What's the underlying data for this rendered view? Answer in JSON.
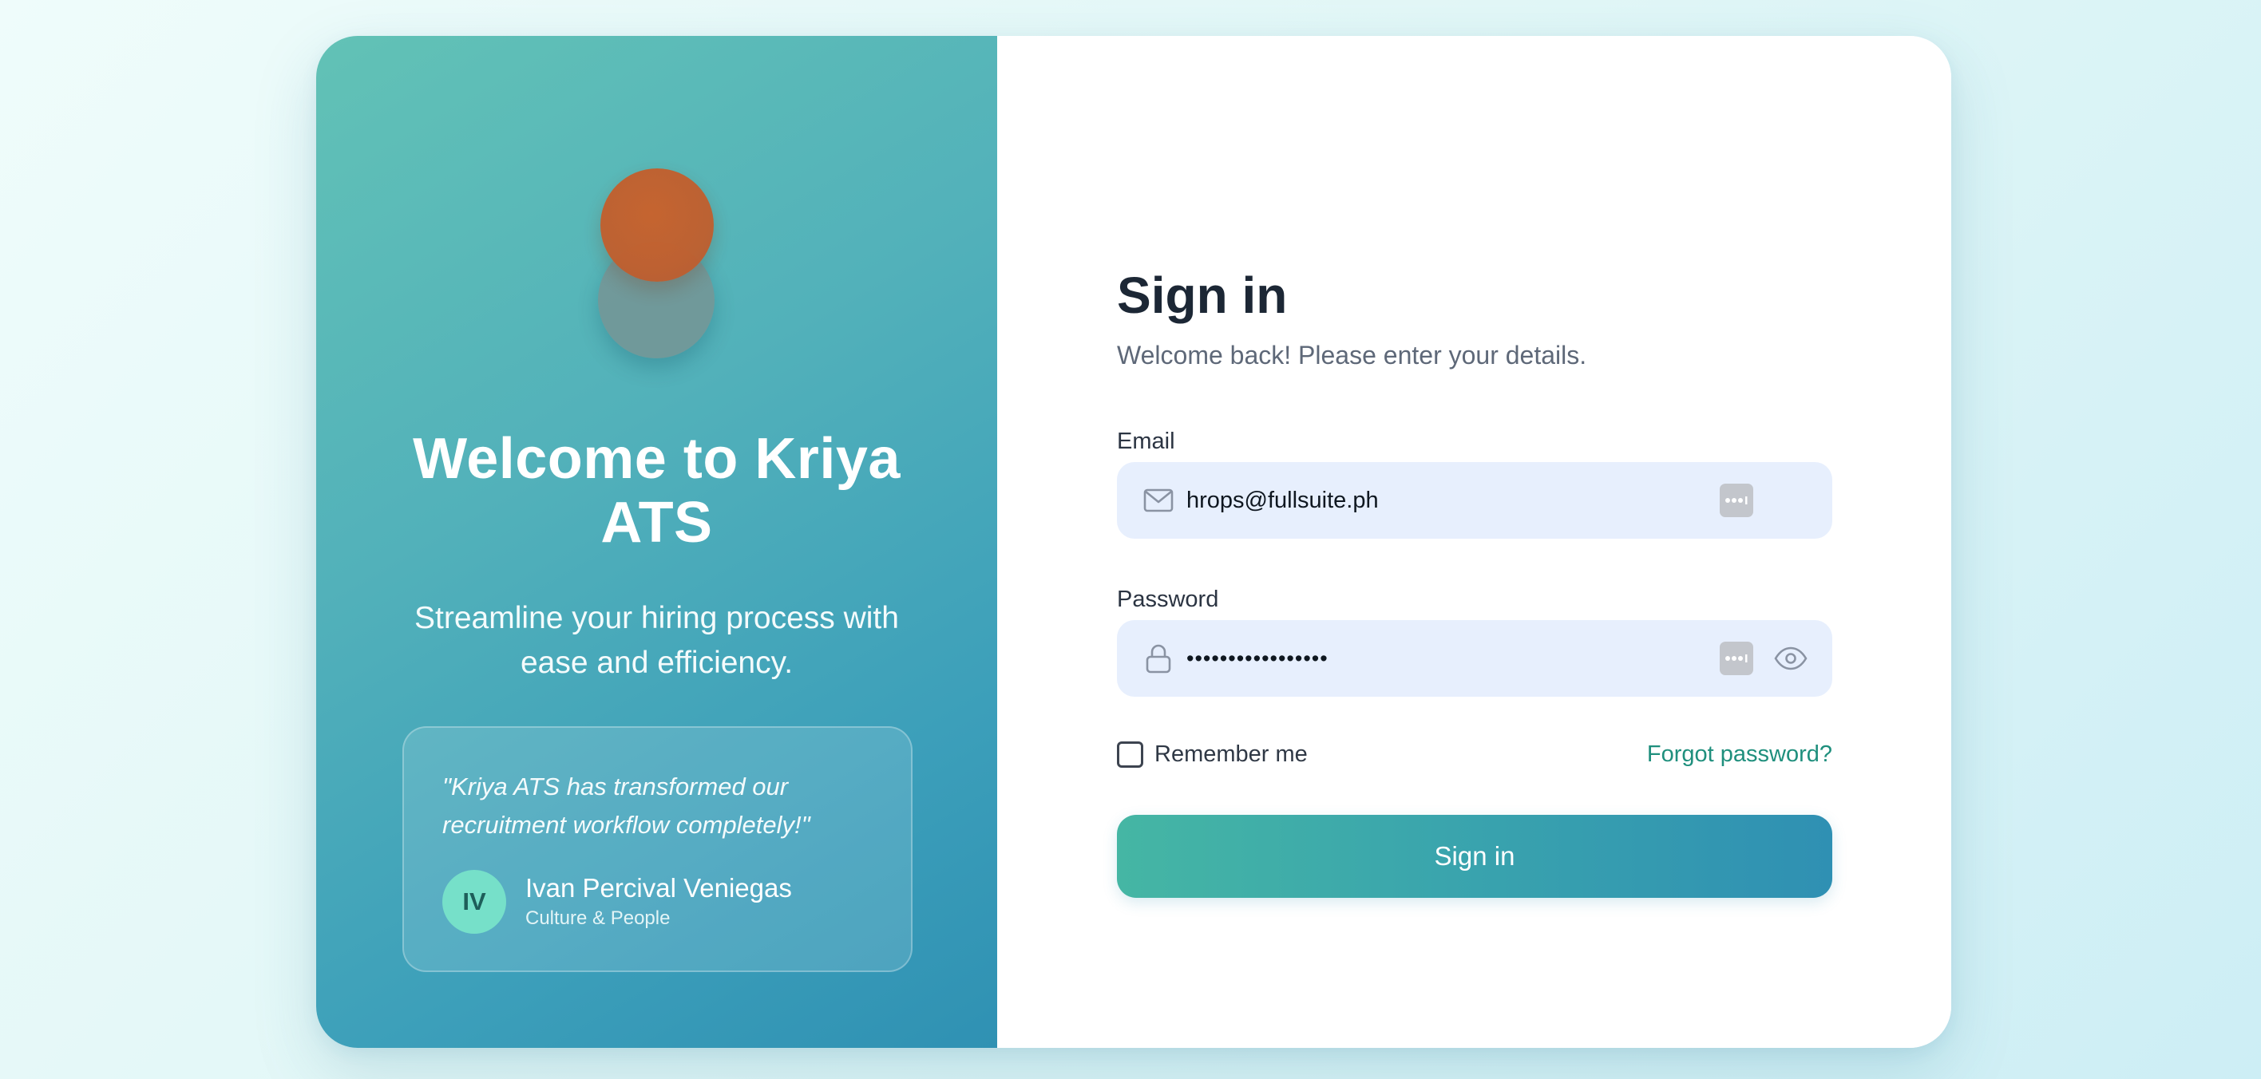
{
  "hero": {
    "title": "Welcome to Kriya ATS",
    "subtitle": "Streamline your hiring process with ease and efficiency.",
    "testimonial": {
      "quote": "\"Kriya ATS has transformed our recruitment workflow completely!\"",
      "avatar_initials": "IV",
      "author_name": "Ivan Percival Veniegas",
      "author_role": "Culture & People"
    },
    "logo_colors": {
      "front": "#c0602f",
      "back": "#769494"
    }
  },
  "form": {
    "title": "Sign in",
    "subtitle": "Welcome back! Please enter your details.",
    "email": {
      "label": "Email",
      "value": "hrops@fullsuite.ph",
      "icon": "mail-icon"
    },
    "password": {
      "label": "Password",
      "value": "•••••••••••••••••",
      "icon": "lock-icon",
      "toggle_icon": "eye-icon"
    },
    "remember_label": "Remember me",
    "forgot_label": "Forgot password?",
    "submit_label": "Sign in"
  },
  "colors": {
    "accent": "#1f8f7d",
    "panel_gradient_start": "#62c2b6",
    "panel_gradient_end": "#2f91b3",
    "input_bg": "#e7effd"
  }
}
